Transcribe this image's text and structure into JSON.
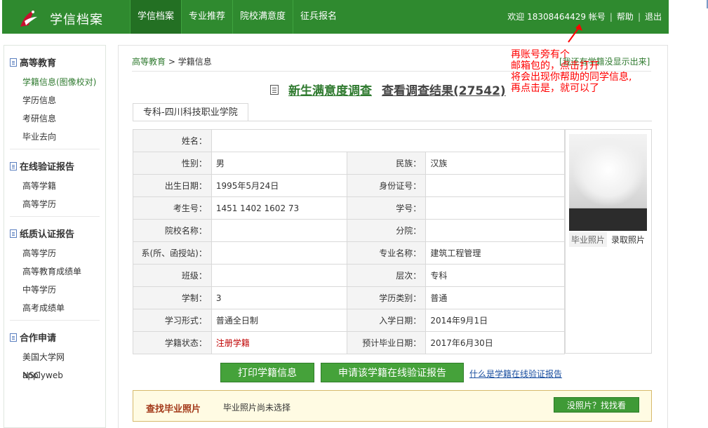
{
  "header": {
    "app_title": "学信档案",
    "nav": [
      {
        "label": "学信档案",
        "active": true
      },
      {
        "label": "专业推荐",
        "active": false
      },
      {
        "label": "院校满意度",
        "active": false
      },
      {
        "label": "征兵报名",
        "active": false
      }
    ],
    "welcome": "欢迎 18308464429 帐号",
    "help": "帮助",
    "logout": "退出",
    "separator": "|"
  },
  "sidebar": {
    "groups": [
      {
        "title": "高等教育",
        "items": [
          "学籍信息(图像校对)",
          "学历信息",
          "考研信息",
          "毕业去向"
        ]
      },
      {
        "title": "在线验证报告",
        "items": [
          "高等学籍",
          "高等学历"
        ]
      },
      {
        "title": "纸质认证报告",
        "items": [
          "高等学历",
          "高等教育成绩单",
          "中等学历",
          "高考成绩单"
        ]
      },
      {
        "title": "合作申请",
        "items": [
          "美国大学网applyweb",
          "NSC"
        ]
      }
    ]
  },
  "main": {
    "breadcrumb": {
      "root": "高等教育",
      "sep": ">",
      "current": "学籍信息"
    },
    "top_link": "[我还有学籍没显示出来]",
    "survey": {
      "link1": "新生满意度调查",
      "link2": "查看调查结果(27542)"
    },
    "tab": "专科-四川科技职业学院",
    "table": {
      "name_label": "姓名：",
      "name_value": "",
      "gender_label": "性别：",
      "gender_value": "男",
      "ethnic_label": "民族：",
      "ethnic_value": "汉族",
      "birth_label": "出生日期：",
      "birth_value": "1995年5月24日",
      "id_label": "身份证号：",
      "id_value": "",
      "exam_label": "考生号：",
      "exam_value": "1451 1402 1602 73",
      "sid_label": "学号：",
      "sid_value": "",
      "school_label": "院校名称：",
      "school_value": "",
      "branch_label": "分院：",
      "branch_value": "",
      "dept_label": "系(所、函授站)：",
      "dept_value": "",
      "major_label": "专业名称：",
      "major_value": "建筑工程管理",
      "class_label": "班级：",
      "class_value": "",
      "level_label": "层次：",
      "level_value": "专科",
      "duration_label": "学制：",
      "duration_value": "3",
      "type_label": "学历类别：",
      "type_value": "普通",
      "form_label": "学习形式：",
      "form_value": "普通全日制",
      "entry_label": "入学日期：",
      "entry_value": "2014年9月1日",
      "status_label": "学籍状态：",
      "status_value": "注册学籍",
      "grad_label": "预计毕业日期：",
      "grad_value": "2017年6月30日"
    },
    "photo": {
      "label1": "毕业照片",
      "label2": "录取照片"
    },
    "buttons": {
      "print": "打印学籍信息",
      "apply": "申请该学籍在线验证报告",
      "what": "什么是学籍在线验证报告"
    },
    "find": {
      "title": "查找毕业照片",
      "text": "毕业照片尚未选择",
      "button": "没照片？找找看"
    }
  },
  "annotation": {
    "lines": [
      "再账号旁有个",
      "邮箱包的，点击打开",
      "将会出现你帮助的同学信息,",
      "再点击是，就可以了"
    ],
    "color": "#ff0000"
  },
  "colors": {
    "brand_green": "#2f8a2f",
    "status_red": "#c00000"
  }
}
